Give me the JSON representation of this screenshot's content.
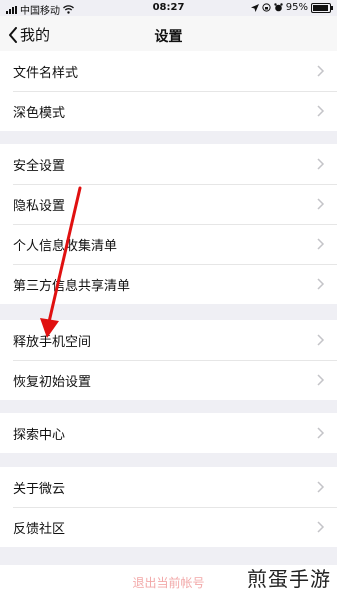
{
  "status_bar": {
    "carrier": "中国移动",
    "time": "08:27",
    "battery_percent": "95%",
    "battery_level": 0.95,
    "icons": [
      "signal-icon",
      "wifi-icon",
      "location-icon",
      "lock-rotation-icon",
      "alarm-icon",
      "battery-icon"
    ]
  },
  "nav": {
    "back_label": "我的",
    "title": "设置"
  },
  "groups": [
    {
      "items": [
        {
          "label": "文件名样式"
        },
        {
          "label": "深色模式"
        }
      ]
    },
    {
      "items": [
        {
          "label": "安全设置"
        },
        {
          "label": "隐私设置"
        },
        {
          "label": "个人信息收集清单"
        },
        {
          "label": "第三方信息共享清单"
        }
      ]
    },
    {
      "items": [
        {
          "label": "释放手机空间"
        },
        {
          "label": "恢复初始设置"
        }
      ]
    },
    {
      "items": [
        {
          "label": "探索中心"
        }
      ]
    },
    {
      "items": [
        {
          "label": "关于微云"
        },
        {
          "label": "反馈社区"
        }
      ]
    }
  ],
  "logout_label": "退出当前帐号",
  "watermark": "煎蛋手游",
  "colors": {
    "background": "#efeff4",
    "annotation_arrow": "#e01010",
    "logout_text": "#f2a8a8"
  }
}
